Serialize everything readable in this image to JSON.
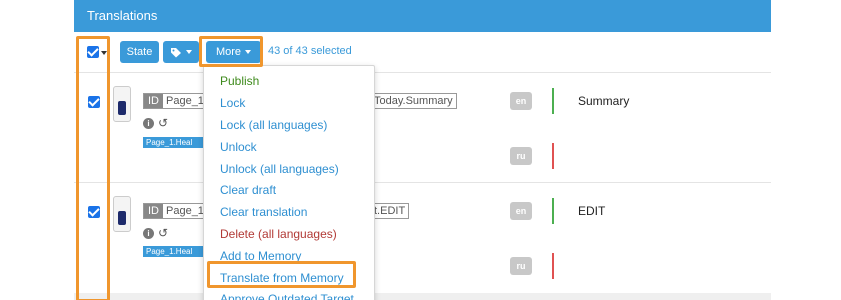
{
  "panel": {
    "title": "Translations"
  },
  "toolbar": {
    "state_label": "State",
    "tags_icon": "tag-icon",
    "more_label": "More",
    "selected_text": "43 of 43 selected"
  },
  "rows": [
    {
      "id_label": "ID",
      "id_value": "Page_1",
      "id_tail": "Today.Summary",
      "tag": "Page_1.Heal",
      "langs": [
        {
          "code": "en",
          "bar_color": "#4caf50",
          "text": "Summary"
        },
        {
          "code": "ru",
          "bar_color": "#e05252",
          "text": ""
        }
      ]
    },
    {
      "id_label": "ID",
      "id_value": "Page_1",
      "id_tail": "t.EDIT",
      "tag": "Page_1.Heal",
      "langs": [
        {
          "code": "en",
          "bar_color": "#4caf50",
          "text": "EDIT"
        },
        {
          "code": "ru",
          "bar_color": "#e05252",
          "text": ""
        }
      ]
    }
  ],
  "menu": {
    "items": [
      {
        "label": "Publish",
        "tone": "green"
      },
      {
        "label": "Lock",
        "tone": "blue"
      },
      {
        "label": "Lock (all languages)",
        "tone": "blue"
      },
      {
        "label": "Unlock",
        "tone": "blue"
      },
      {
        "label": "Unlock (all languages)",
        "tone": "blue"
      },
      {
        "label": "Clear draft",
        "tone": "blue"
      },
      {
        "label": "Clear translation",
        "tone": "blue"
      },
      {
        "label": "Delete (all languages)",
        "tone": "red"
      },
      {
        "label": "Add to Memory",
        "tone": "blue"
      },
      {
        "label": "Translate from Memory",
        "tone": "blue"
      },
      {
        "label": "Approve Outdated Target",
        "tone": "blue"
      }
    ]
  },
  "colors": {
    "accent": "#3a9ad9",
    "highlight": "#f0962d"
  }
}
